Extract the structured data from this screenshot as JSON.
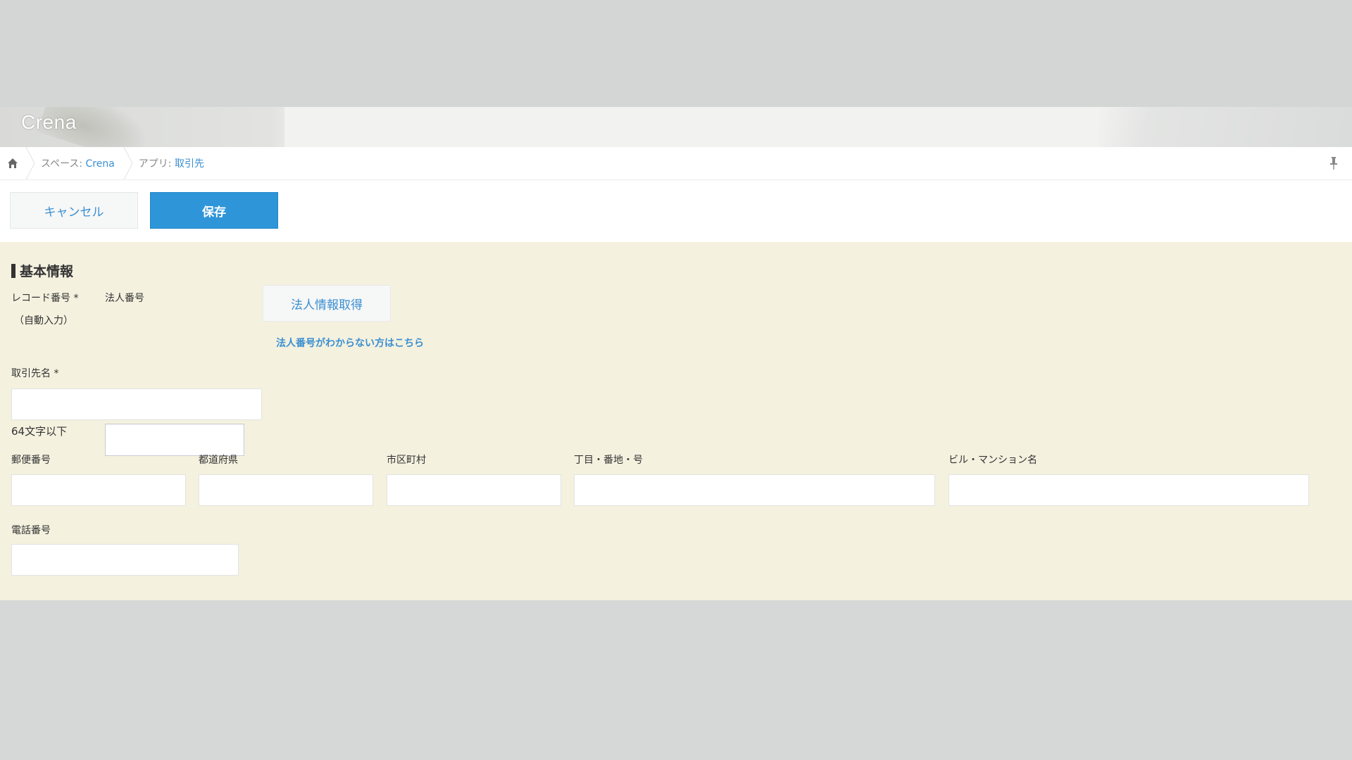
{
  "header": {
    "logo_text": "Crena"
  },
  "breadcrumb": {
    "space_prefix": "スペース: ",
    "space_name": "Crena",
    "app_prefix": "アプリ: ",
    "app_name": "取引先"
  },
  "toolbar": {
    "cancel_label": "キャンセル",
    "save_label": "保存"
  },
  "form": {
    "section_title": "基本情報",
    "record_number_label": "レコード番号",
    "record_number_value": "（自動入力）",
    "corp_number_label": "法人番号",
    "corp_number_value": "",
    "corp_info_button": "法人情報取得",
    "corp_help_link": "法人番号がわからない方はこちら",
    "company_name_label": "取引先名",
    "company_name_value": "",
    "company_name_hint": "64文字以下",
    "postal_label": "郵便番号",
    "prefecture_label": "都道府県",
    "city_label": "市区町村",
    "street_label": "丁目・番地・号",
    "building_label": "ビル・マンション名",
    "phone_label": "電話番号",
    "required_mark": "*"
  },
  "colors": {
    "accent": "#2e95d8",
    "link": "#3b8fd1",
    "form_background": "#f4f1df"
  }
}
